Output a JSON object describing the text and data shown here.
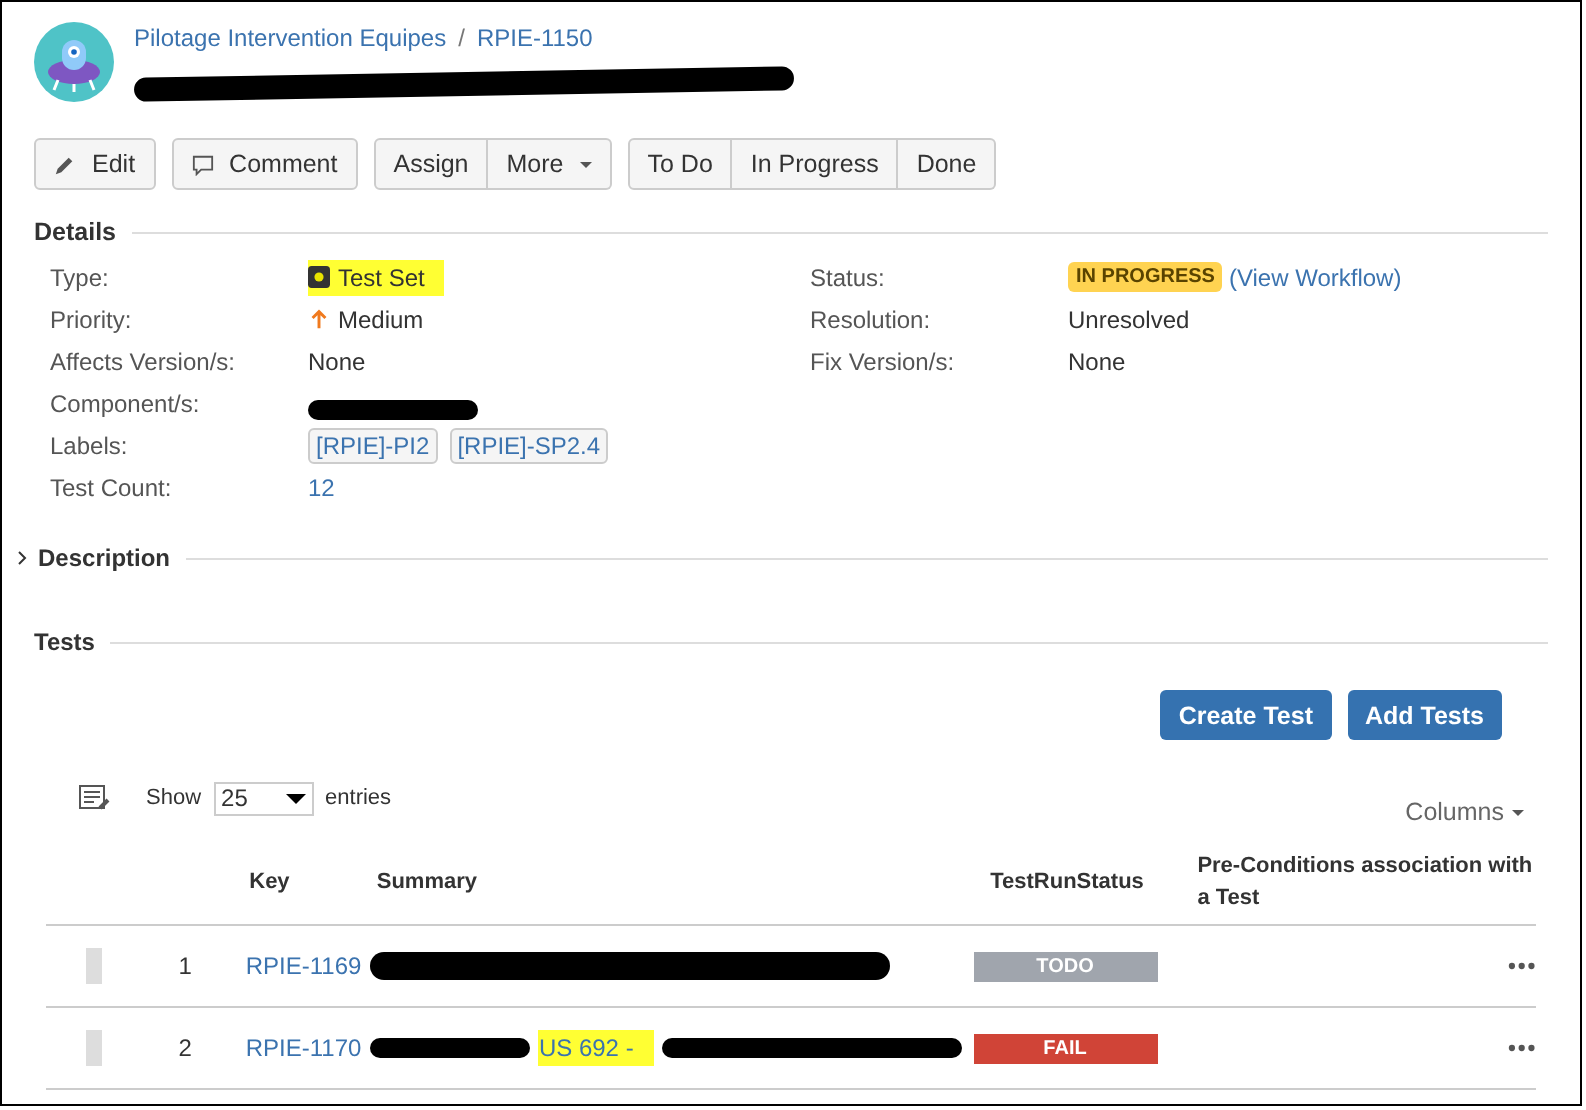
{
  "header": {
    "project": "Pilotage Intervention Equipes",
    "separator": "/",
    "issue_key": "RPIE-1150"
  },
  "actions": [
    {
      "label": "Edit",
      "kind": "edit"
    },
    {
      "label": "Comment",
      "kind": "comment"
    }
  ],
  "action_group": [
    {
      "label": "Assign",
      "caret": false
    },
    {
      "label": "More",
      "caret": true
    }
  ],
  "workflow": [
    "To Do",
    "In Progress",
    "Done"
  ],
  "details": {
    "title": "Details",
    "left": [
      {
        "label": "Type:",
        "kind": "type",
        "value": "Test Set",
        "highlighted": true
      },
      {
        "label": "Priority:",
        "kind": "priority",
        "value": "Medium"
      },
      {
        "label": "Affects Version/s:",
        "kind": "plain",
        "value": "None"
      },
      {
        "label": "Component/s:",
        "kind": "redacted"
      },
      {
        "label": "Labels:",
        "kind": "labels",
        "labels": [
          "[RPIE]-PI2",
          "[RPIE]-SP2.4"
        ]
      },
      {
        "label": "Test Count:",
        "kind": "link",
        "value": "12"
      }
    ],
    "right": [
      {
        "label": "Status:",
        "kind": "status",
        "value": "IN PROGRESS",
        "link": "(View Workflow)"
      },
      {
        "label": "Resolution:",
        "kind": "plain",
        "value": "Unresolved"
      },
      {
        "label": "Fix Version/s:",
        "kind": "plain",
        "value": "None"
      }
    ]
  },
  "description": {
    "title": "Description",
    "expanded": false
  },
  "tests": {
    "title": "Tests",
    "buttons": [
      "Create Test",
      "Add Tests"
    ],
    "show_label": "Show",
    "page_size": "25",
    "entries_label": "entries",
    "columns_button": "Columns",
    "columns": [
      "Key",
      "Summary",
      "TestRunStatus",
      "Pre-Conditions association with a Test"
    ],
    "rows": [
      {
        "index": "1",
        "key": "RPIE-1169",
        "status": "TODO",
        "kind": "todo"
      },
      {
        "index": "2",
        "key": "RPIE-1170",
        "summary_highlight": "US 692 -",
        "status": "FAIL",
        "kind": "fail"
      }
    ]
  }
}
